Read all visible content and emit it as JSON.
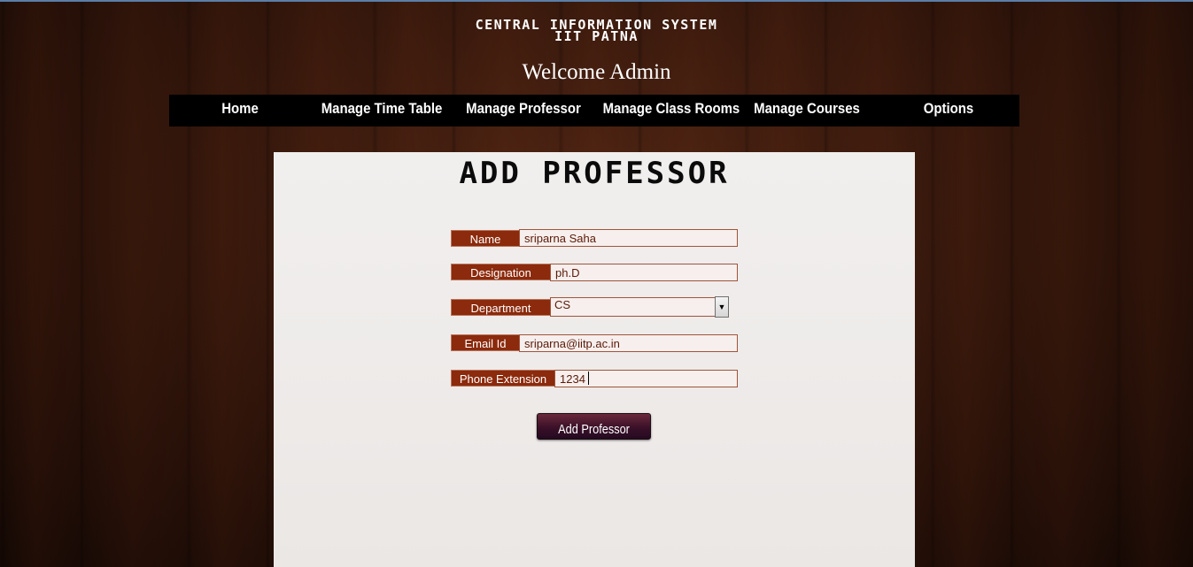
{
  "header": {
    "title_line1": "CENTRAL INFORMATION SYSTEM",
    "title_line2": "IIT PATNA",
    "welcome": "Welcome Admin"
  },
  "nav": {
    "items": [
      {
        "label": "Home"
      },
      {
        "label": "Manage Time Table"
      },
      {
        "label": "Manage Professor"
      },
      {
        "label": "Manage Class Rooms"
      },
      {
        "label": "Manage Courses"
      },
      {
        "label": "Options"
      }
    ]
  },
  "form": {
    "title": "ADD PROFESSOR",
    "name": {
      "label": "Name",
      "value": "sriparna Saha"
    },
    "designation": {
      "label": "Designation",
      "value": "ph.D"
    },
    "department": {
      "label": "Department",
      "value": "CS"
    },
    "email": {
      "label": "Email Id",
      "value": "sriparna@iitp.ac.in"
    },
    "phone": {
      "label": "Phone Extension",
      "value": "1234"
    },
    "submit_label": "Add Professor"
  },
  "colors": {
    "label_bg": "#8b2a0c",
    "nav_bg": "#000000",
    "button_bg": "#3a1028"
  }
}
